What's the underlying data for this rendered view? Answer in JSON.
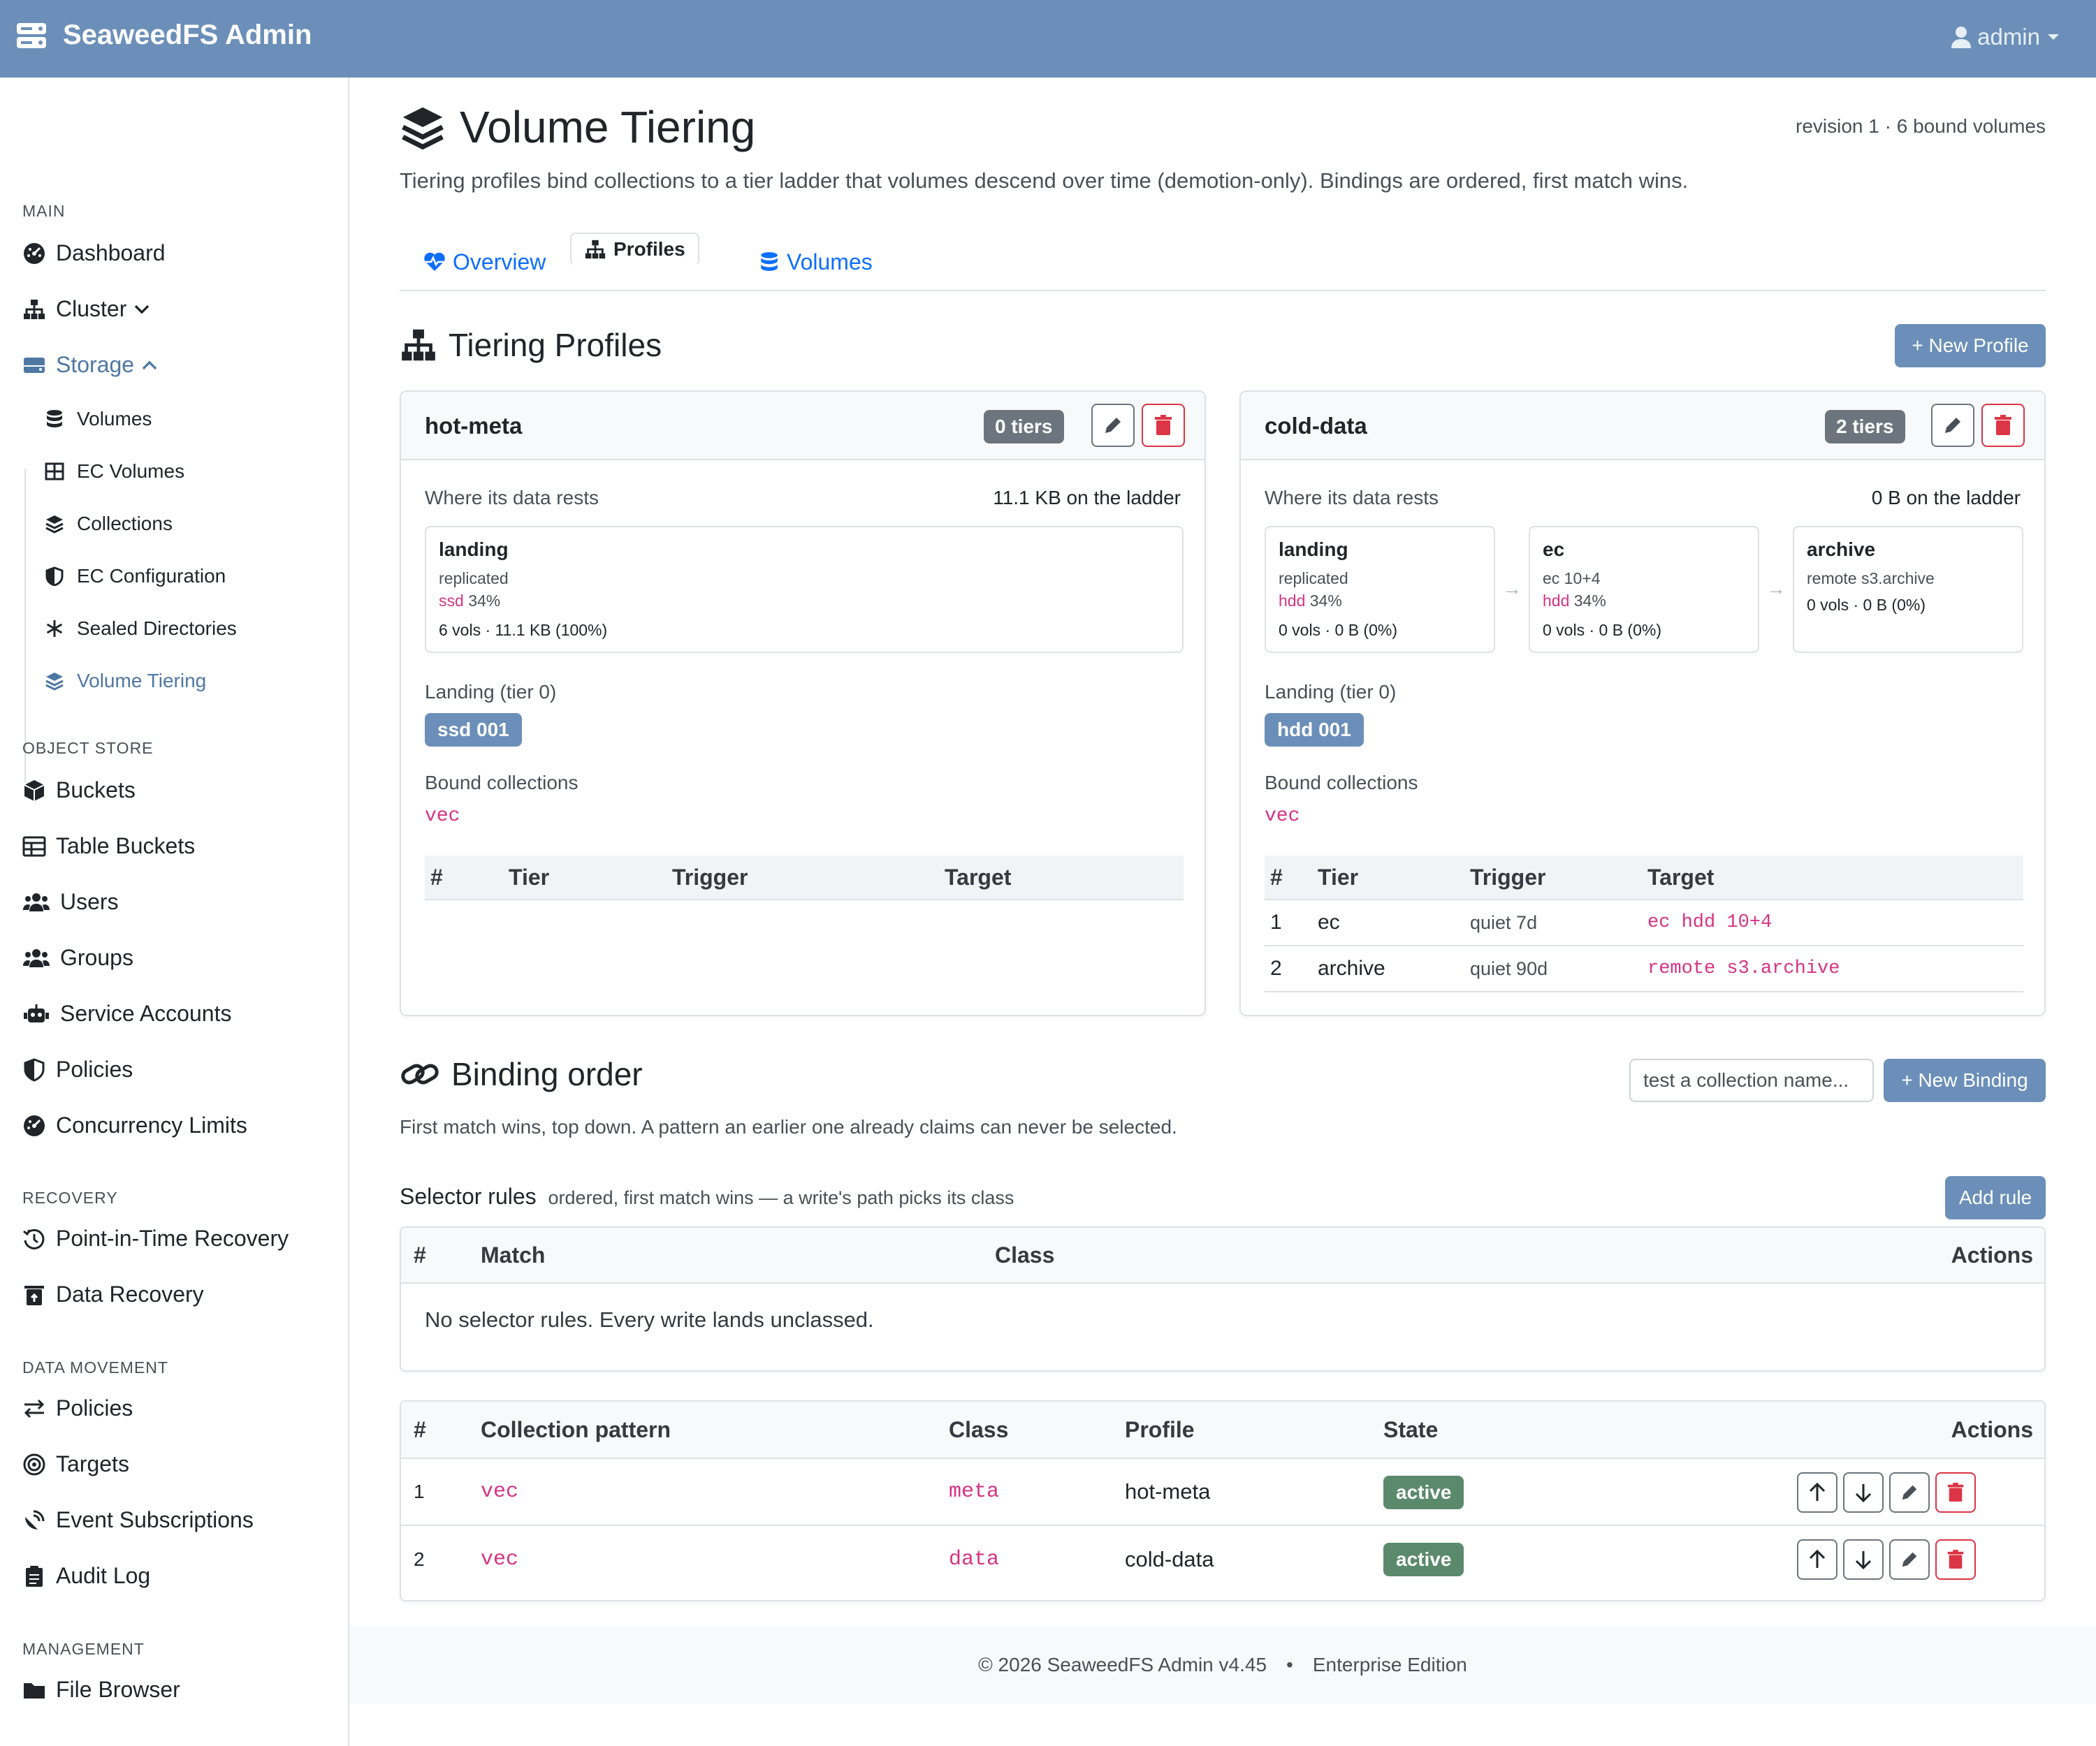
{
  "app": {
    "title": "SeaweedFS Admin",
    "user": "admin"
  },
  "sidebar": {
    "sections": {
      "main": "MAIN",
      "object_store": "OBJECT STORE",
      "recovery": "RECOVERY",
      "data_movement": "DATA MOVEMENT",
      "management": "MANAGEMENT"
    },
    "items": {
      "dashboard": "Dashboard",
      "cluster": "Cluster",
      "storage": "Storage",
      "volumes": "Volumes",
      "ec_volumes": "EC Volumes",
      "collections": "Collections",
      "ec_configuration": "EC Configuration",
      "sealed_directories": "Sealed Directories",
      "volume_tiering": "Volume Tiering",
      "buckets": "Buckets",
      "table_buckets": "Table Buckets",
      "users": "Users",
      "groups": "Groups",
      "service_accounts": "Service Accounts",
      "policies": "Policies",
      "concurrency_limits": "Concurrency Limits",
      "pitr": "Point-in-Time Recovery",
      "data_recovery": "Data Recovery",
      "dm_policies": "Policies",
      "targets": "Targets",
      "event_subscriptions": "Event Subscriptions",
      "audit_log": "Audit Log",
      "file_browser": "File Browser"
    }
  },
  "page": {
    "title": "Volume Tiering",
    "meta": "revision 1 · 6 bound volumes",
    "lead": "Tiering profiles bind collections to a tier ladder that volumes descend over time (demotion-only). Bindings are ordered, first match wins.",
    "tabs": {
      "overview": "Overview",
      "profiles": "Profiles",
      "volumes": "Volumes"
    }
  },
  "profiles": {
    "heading": "Tiering Profiles",
    "new_button": "+ New Profile",
    "where_label": "Where its data rests",
    "landing_label": "Landing (tier 0)",
    "bound_label": "Bound collections",
    "cols": {
      "num": "#",
      "tier": "Tier",
      "trigger": "Trigger",
      "target": "Target"
    },
    "hot": {
      "name": "hot-meta",
      "badge": "0 tiers",
      "ladder": "11.1 KB on the ladder",
      "tier0": {
        "name": "landing",
        "kind": "replicated",
        "disk": "ssd",
        "pct": "34%",
        "stats": "6 vols · 11.1 KB (100%)"
      },
      "landing": "ssd 001",
      "bound": "vec"
    },
    "cold": {
      "name": "cold-data",
      "badge": "2 tiers",
      "ladder": "0 B on the ladder",
      "tier0": {
        "name": "landing",
        "kind": "replicated",
        "disk": "hdd",
        "pct": "34%",
        "stats": "0 vols · 0 B (0%)"
      },
      "tier1": {
        "name": "ec",
        "kind": "ec 10+4",
        "disk": "hdd",
        "pct": "34%",
        "stats": "0 vols · 0 B (0%)"
      },
      "tier2": {
        "name": "archive",
        "kind": "remote s3.archive",
        "stats": "0 vols · 0 B (0%)"
      },
      "landing": "hdd 001",
      "bound": "vec",
      "rows": [
        {
          "num": "1",
          "tier": "ec",
          "trigger": "quiet 7d",
          "target": "ec hdd 10+4"
        },
        {
          "num": "2",
          "tier": "archive",
          "trigger": "quiet 90d",
          "target": "remote s3.archive"
        }
      ]
    }
  },
  "binding": {
    "heading": "Binding order",
    "test_placeholder": "test a collection name...",
    "new_button": "+ New Binding",
    "note": "First match wins, top down. A pattern an earlier one already claims can never be selected.",
    "selector_title": "Selector rules",
    "selector_sub": "ordered, first match wins — a write's path picks its class",
    "add_rule": "Add rule",
    "selector_cols": {
      "num": "#",
      "match": "Match",
      "class": "Class",
      "actions": "Actions"
    },
    "selector_empty": "No selector rules. Every write lands unclassed.",
    "cols": {
      "num": "#",
      "pattern": "Collection pattern",
      "class": "Class",
      "profile": "Profile",
      "state": "State",
      "actions": "Actions"
    },
    "rows": [
      {
        "num": "1",
        "pattern": "vec",
        "class": "meta",
        "profile": "hot-meta",
        "state": "active"
      },
      {
        "num": "2",
        "pattern": "vec",
        "class": "data",
        "profile": "cold-data",
        "state": "active"
      }
    ]
  },
  "footer": {
    "copyright": "© 2026 SeaweedFS Admin v4.45",
    "sep": "•",
    "edition": "Enterprise Edition"
  },
  "colors": {
    "navbar": "#6b8fb8",
    "accent": "#4f77a3",
    "danger": "#dc3545",
    "code": "#d63384",
    "active": "#5a8a6b"
  }
}
